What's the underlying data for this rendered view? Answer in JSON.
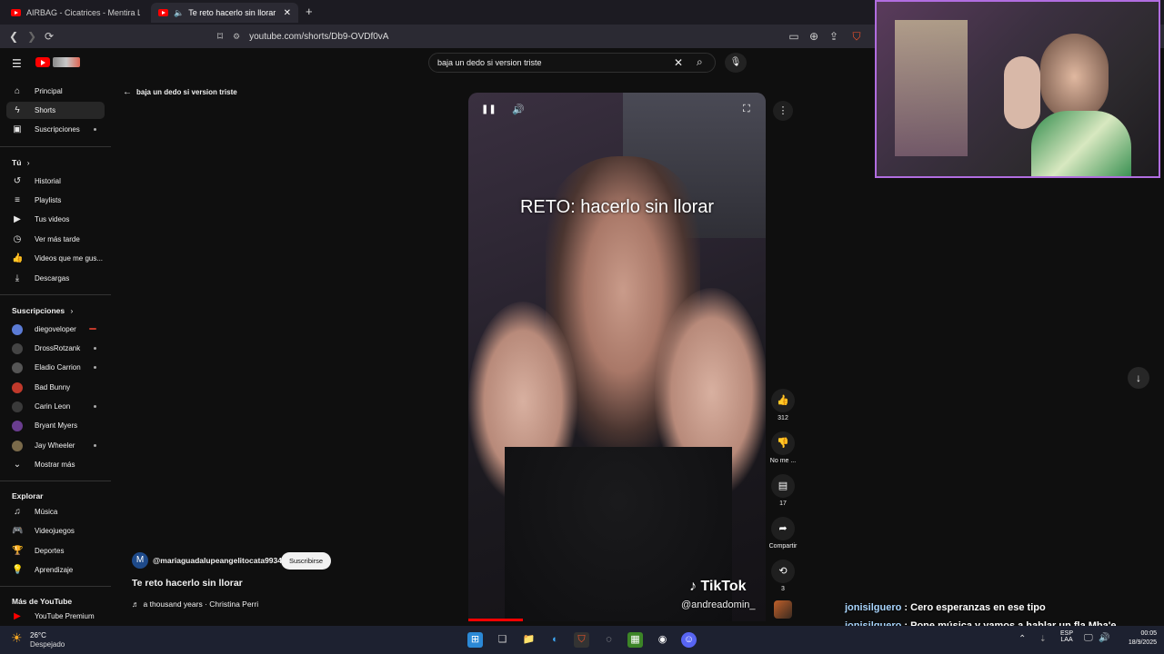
{
  "browser": {
    "tabs": [
      {
        "title": "AIRBAG - Cicatrices - Mentira La Verdad"
      },
      {
        "title": "Te reto hacerlo sin llorar - YouTube"
      }
    ],
    "url": "youtube.com/shorts/Db9-OVDf0vA"
  },
  "youtube": {
    "search_value": "baja un dedo si version triste",
    "back_label": "baja un dedo si version triste",
    "sidebar": {
      "main": [
        {
          "label": "Principal",
          "icon": "home-icon"
        },
        {
          "label": "Shorts",
          "icon": "shorts-icon"
        },
        {
          "label": "Suscripciones",
          "icon": "subscriptions-icon"
        }
      ],
      "you_header": "Tú",
      "you": [
        {
          "label": "Historial",
          "icon": "history-icon"
        },
        {
          "label": "Playlists",
          "icon": "playlists-icon"
        },
        {
          "label": "Tus videos",
          "icon": "your-videos-icon"
        },
        {
          "label": "Ver más tarde",
          "icon": "watch-later-icon"
        },
        {
          "label": "Videos que me gus...",
          "icon": "liked-videos-icon"
        },
        {
          "label": "Descargas",
          "icon": "downloads-icon"
        }
      ],
      "subs_header": "Suscripciones",
      "subs": [
        {
          "label": "diegoveloper",
          "color": "#5b7bd5"
        },
        {
          "label": "DrossRotzank",
          "color": "#444444"
        },
        {
          "label": "Eladio Carrion",
          "color": "#555555"
        },
        {
          "label": "Bad Bunny",
          "color": "#c0392b"
        },
        {
          "label": "Carin Leon",
          "color": "#3a3a3a"
        },
        {
          "label": "Bryant Myers",
          "color": "#6a3d8f"
        },
        {
          "label": "Jay Wheeler",
          "color": "#7a6a4a"
        }
      ],
      "show_more": "Mostrar más",
      "explore_header": "Explorar",
      "explore": [
        {
          "label": "Música",
          "icon": "music-icon"
        },
        {
          "label": "Videojuegos",
          "icon": "gaming-icon"
        },
        {
          "label": "Deportes",
          "icon": "trophy-icon"
        },
        {
          "label": "Aprendizaje",
          "icon": "lightbulb-icon"
        }
      ],
      "more_header": "Más de YouTube",
      "more": [
        {
          "label": "YouTube Premium",
          "icon": "youtube-premium-icon"
        }
      ]
    },
    "short": {
      "overlay_text": "RETO: hacerlo sin llorar",
      "watermark_brand": "TikTok",
      "watermark_user": "@andreadomin_",
      "channel": "@mariaguadalupeangelitocata9934",
      "channel_initial": "M",
      "subscribe_label": "Suscribirse",
      "title": "Te reto hacerlo sin llorar",
      "music": "a thousand years · Christina Perri"
    },
    "actions": {
      "likes": "312",
      "dislike_label": "No me ...",
      "comments": "17",
      "share_label": "Compartir",
      "remix_count": "3"
    }
  },
  "stream": {
    "chat": [
      {
        "user": "jonisilguero",
        "message": "Cero esperanzas en ese tipo"
      },
      {
        "user": "jonisilguero",
        "message": "Pone música y vamos a hablar un fla Mba'e"
      }
    ]
  },
  "taskbar": {
    "weather_temp": "26°C",
    "weather_desc": "Despejado",
    "lang_top": "ESP",
    "lang_bottom": "LAA",
    "time": "00:05",
    "date": "18/9/2025"
  }
}
